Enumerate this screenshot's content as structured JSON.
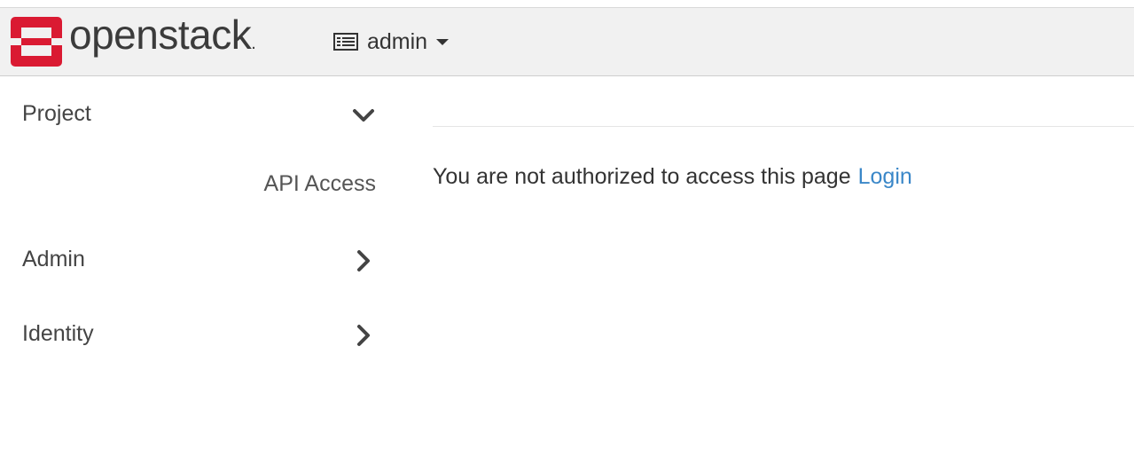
{
  "header": {
    "brand_name": "openstack",
    "brand_dot": ".",
    "project_selector": {
      "label": "admin",
      "icon": "project-grid-icon"
    }
  },
  "sidebar": {
    "items": [
      {
        "label": "Project",
        "icon": "chevron-down-icon",
        "expanded": true,
        "subitems": [
          {
            "label": "API Access"
          }
        ]
      },
      {
        "label": "Admin",
        "icon": "chevron-right-icon",
        "expanded": false
      },
      {
        "label": "Identity",
        "icon": "chevron-right-icon",
        "expanded": false
      }
    ]
  },
  "main": {
    "message": "You are not authorized to access this page",
    "login_link": "Login"
  },
  "colors": {
    "brand_red": "#da1a32",
    "navbar_bg": "#f1f1f1",
    "link": "#3a87c8",
    "text": "#333333"
  }
}
